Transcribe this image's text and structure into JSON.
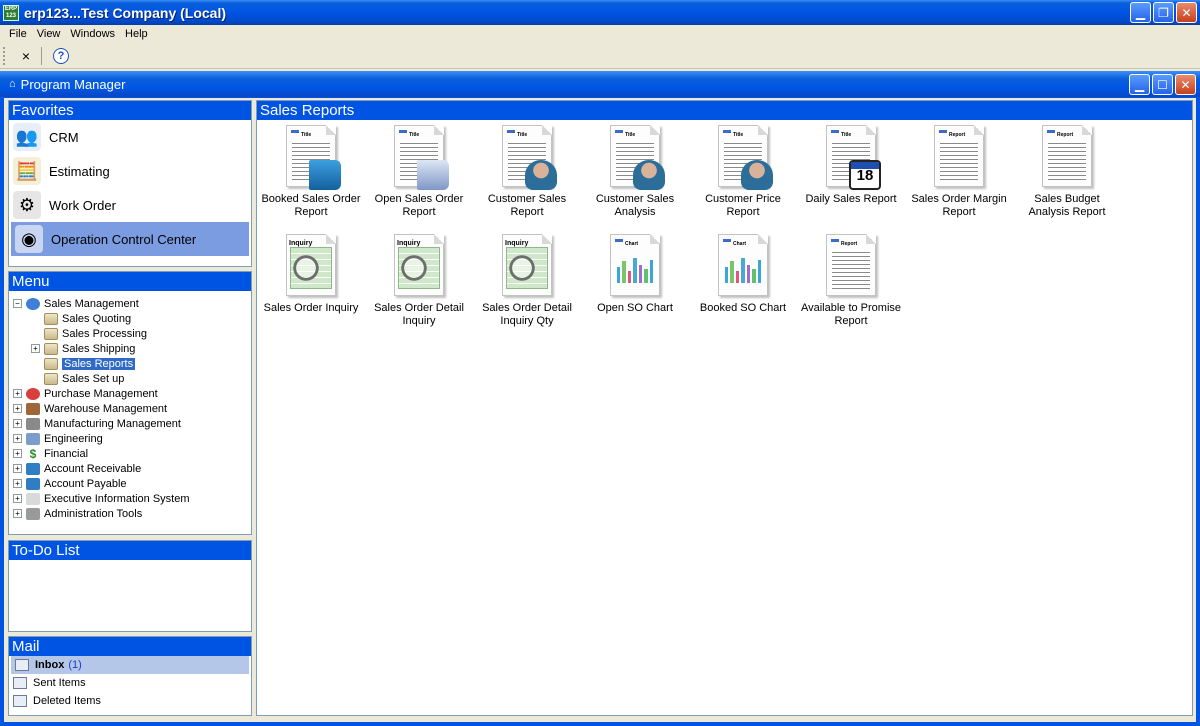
{
  "window": {
    "title": "erp123...Test Company (Local)",
    "app_icon_text": "ERP 123"
  },
  "menubar": [
    {
      "label": "File"
    },
    {
      "label": "View"
    },
    {
      "label": "Windows"
    },
    {
      "label": "Help"
    }
  ],
  "toolbar": {
    "close_symbol": "×",
    "help_symbol": "?"
  },
  "program_manager": {
    "title": "Program Manager"
  },
  "favorites": {
    "header": "Favorites",
    "items": [
      {
        "label": "CRM",
        "icon": "people-icon"
      },
      {
        "label": "Estimating",
        "icon": "calculator-icon"
      },
      {
        "label": "Work Order",
        "icon": "gear-icon"
      },
      {
        "label": "Operation Control Center",
        "icon": "control-center-icon",
        "selected": true
      }
    ]
  },
  "menu": {
    "header": "Menu",
    "tree": [
      {
        "label": "Sales Management",
        "level": 0,
        "expander": "−",
        "icon": "globe-icon"
      },
      {
        "label": "Sales Quoting",
        "level": 1,
        "expander": "",
        "icon": "folder-icon"
      },
      {
        "label": "Sales Processing",
        "level": 1,
        "expander": "",
        "icon": "folder-icon"
      },
      {
        "label": "Sales Shipping",
        "level": 1,
        "expander": "+",
        "icon": "folder-icon"
      },
      {
        "label": "Sales Reports",
        "level": 1,
        "expander": "",
        "icon": "folder-icon",
        "selected": true
      },
      {
        "label": "Sales Set up",
        "level": 1,
        "expander": "",
        "icon": "folder-icon"
      },
      {
        "label": "Purchase Management",
        "level": 0,
        "expander": "+",
        "icon": "purchase-icon"
      },
      {
        "label": "Warehouse Management",
        "level": 0,
        "expander": "+",
        "icon": "warehouse-icon"
      },
      {
        "label": "Manufacturing Management",
        "level": 0,
        "expander": "+",
        "icon": "gear-icon"
      },
      {
        "label": "Engineering",
        "level": 0,
        "expander": "+",
        "icon": "engineering-icon"
      },
      {
        "label": "Financial",
        "level": 0,
        "expander": "+",
        "icon": "dollar-icon"
      },
      {
        "label": "Account Receivable",
        "level": 0,
        "expander": "+",
        "icon": "book-icon"
      },
      {
        "label": "Account Payable",
        "level": 0,
        "expander": "+",
        "icon": "book-icon"
      },
      {
        "label": "Executive Information System",
        "level": 0,
        "expander": "+",
        "icon": "document-icon"
      },
      {
        "label": "Administration Tools",
        "level": 0,
        "expander": "+",
        "icon": "tools-icon"
      }
    ]
  },
  "todo": {
    "header": "To-Do List"
  },
  "mail": {
    "header": "Mail",
    "items": [
      {
        "label": "Inbox",
        "count": "(1)",
        "selected": true
      },
      {
        "label": "Sent Items",
        "count": ""
      },
      {
        "label": "Deleted Items",
        "count": ""
      }
    ]
  },
  "main": {
    "header": "Sales Reports",
    "reports": [
      {
        "label": "Booked Sales Order Report",
        "kind": "report",
        "tag": "Title",
        "badge": "book"
      },
      {
        "label": "Open Sales Order Report",
        "kind": "report",
        "tag": "Title",
        "badge": "newspaper"
      },
      {
        "label": "Customer Sales Report",
        "kind": "report",
        "tag": "Title",
        "badge": "person"
      },
      {
        "label": "Customer Sales Analysis",
        "kind": "report",
        "tag": "Title",
        "badge": "person"
      },
      {
        "label": "Customer Price Report",
        "kind": "report",
        "tag": "Title",
        "badge": "person"
      },
      {
        "label": "Daily Sales Report",
        "kind": "report",
        "tag": "Title",
        "badge": "calendar",
        "badge_text": "18"
      },
      {
        "label": "Sales Order Margin Report",
        "kind": "report",
        "tag": "Report",
        "badge": ""
      },
      {
        "label": "Sales Budget Analysis Report",
        "kind": "report",
        "tag": "Report",
        "badge": ""
      },
      {
        "label": "Sales Order Inquiry",
        "kind": "inquiry",
        "tag": "Inquiry"
      },
      {
        "label": "Sales Order Detail Inquiry",
        "kind": "inquiry",
        "tag": "Inquiry"
      },
      {
        "label": "Sales Order Detail Inquiry Qty",
        "kind": "inquiry",
        "tag": "Inquiry"
      },
      {
        "label": "Open SO Chart",
        "kind": "chart",
        "tag": "Chart"
      },
      {
        "label": "Booked SO Chart",
        "kind": "chart",
        "tag": "Chart"
      },
      {
        "label": "Available to Promise Report",
        "kind": "report",
        "tag": "Report",
        "badge": ""
      }
    ]
  },
  "colors": {
    "xp_blue": "#0054e3",
    "selection": "#316ac5",
    "favorite_selected": "#7c9ce2",
    "background": "#ece9d8"
  }
}
